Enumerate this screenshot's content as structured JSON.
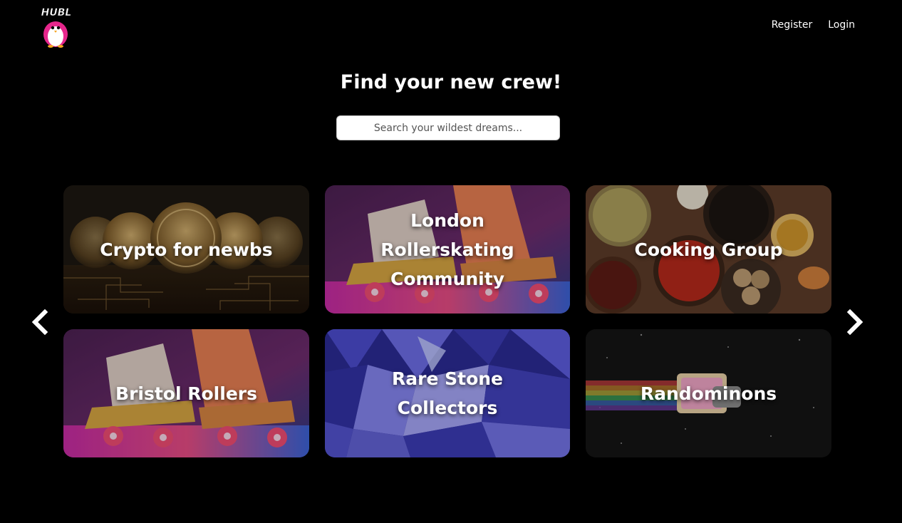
{
  "header": {
    "logo_text": "HUBL",
    "nav": {
      "register": "Register",
      "login": "Login"
    }
  },
  "hero": {
    "title": "Find your new crew!",
    "search_placeholder": "Search your wildest dreams..."
  },
  "carousel": {
    "prev_icon": "chevron-left-icon",
    "next_icon": "chevron-right-icon",
    "cards": [
      {
        "title": "Crypto for newbs",
        "theme": "bitcoin-coins"
      },
      {
        "title": "London Rollerskating Community",
        "theme": "roller-skates"
      },
      {
        "title": "Cooking Group",
        "theme": "spices"
      },
      {
        "title": "Bristol Rollers",
        "theme": "roller-skates"
      },
      {
        "title": "Rare Stone Collectors",
        "theme": "crystals"
      },
      {
        "title": "Randominons",
        "theme": "space-cat"
      }
    ]
  },
  "colors": {
    "background": "#000000",
    "text": "#ffffff",
    "logo_accent": "#e6268c"
  }
}
